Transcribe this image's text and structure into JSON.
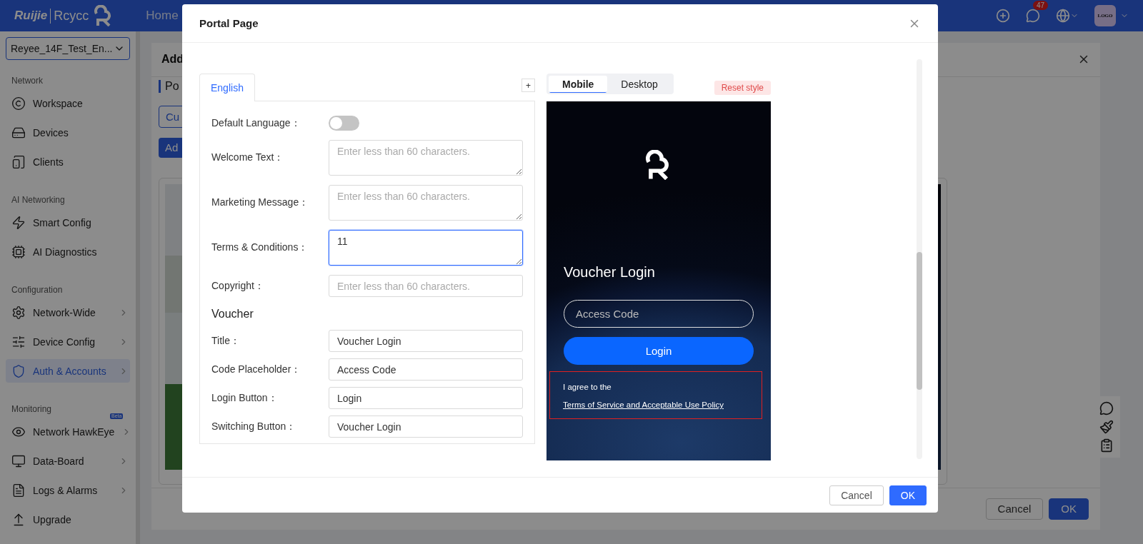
{
  "topbar": {
    "brand": "Ruijie",
    "brand_product": "Rcycc",
    "nav": "Home",
    "notification_count": "47",
    "avatar": "LOGO"
  },
  "sidebar": {
    "site": "Reyee_14F_Test_En...",
    "groups": [
      {
        "title": "Network",
        "items": [
          {
            "label": "Workspace",
            "selected": false,
            "expandable": false
          },
          {
            "label": "Devices",
            "selected": false,
            "expandable": false
          },
          {
            "label": "Clients",
            "selected": false,
            "expandable": false
          }
        ]
      },
      {
        "title": "AI Networking",
        "items": [
          {
            "label": "Smart Config",
            "selected": false,
            "expandable": false
          },
          {
            "label": "AI Diagnostics",
            "selected": false,
            "expandable": false
          }
        ]
      },
      {
        "title": "Configuration",
        "items": [
          {
            "label": "Network-Wide",
            "selected": false,
            "expandable": true
          },
          {
            "label": "Device Config",
            "selected": false,
            "expandable": true
          },
          {
            "label": "Auth & Accounts",
            "selected": true,
            "expandable": true
          }
        ]
      },
      {
        "title": "Monitoring",
        "items": [
          {
            "label": "Network HawkEye",
            "selected": false,
            "expandable": true,
            "badge": "Beta"
          },
          {
            "label": "Data-Board",
            "selected": false,
            "expandable": true
          },
          {
            "label": "Logs & Alarms",
            "selected": false,
            "expandable": true
          },
          {
            "label": "Upgrade",
            "selected": false,
            "expandable": false
          }
        ]
      }
    ]
  },
  "drawer": {
    "title": "Add",
    "section": "Po",
    "outline_button": "Cu",
    "primary_button": "Ad",
    "buttons": [
      "Cancel",
      "OK"
    ]
  },
  "modal": {
    "title": "Portal Page",
    "language_tabs": [
      {
        "label": "English",
        "selected": true
      }
    ],
    "add_tab": "+",
    "default_language": {
      "label": "Default Language：",
      "on": false
    },
    "fields": [
      {
        "kind": "textarea",
        "label": "Welcome Text：",
        "placeholder": "Enter less than 60 characters.",
        "focused": false
      },
      {
        "kind": "textarea",
        "label": "Marketing Message：",
        "placeholder": "Enter less than 60 characters.",
        "focused": false
      },
      {
        "kind": "textarea",
        "label": "Terms & Conditions：",
        "value": "11",
        "focused": true
      },
      {
        "kind": "input",
        "label": "Copyright：",
        "placeholder": "Enter less than 60 characters.",
        "focused": false
      }
    ],
    "voucher": {
      "heading": "Voucher",
      "fields": [
        {
          "kind": "input",
          "label": "Title：",
          "value": "Voucher Login",
          "focused": false
        },
        {
          "kind": "input",
          "label": "Code Placeholder：",
          "value": "Access Code",
          "focused": false
        },
        {
          "kind": "input",
          "label": "Login Button：",
          "value": "Login",
          "focused": false
        },
        {
          "kind": "input",
          "label": "Switching Button：",
          "value": "Voucher Login",
          "focused": false
        }
      ]
    },
    "preview_tabs": [
      {
        "label": "Mobile",
        "selected": true
      },
      {
        "label": "Desktop",
        "selected": false
      }
    ],
    "reset_style": "Reset style",
    "preview": {
      "title": "Voucher Login",
      "code_placeholder": "Access Code",
      "login_button": "Login",
      "agreement": "I agree to the ",
      "agreement_link": "Terms of Service and Acceptable Use Policy"
    },
    "buttons": [
      "Cancel",
      "OK"
    ]
  }
}
